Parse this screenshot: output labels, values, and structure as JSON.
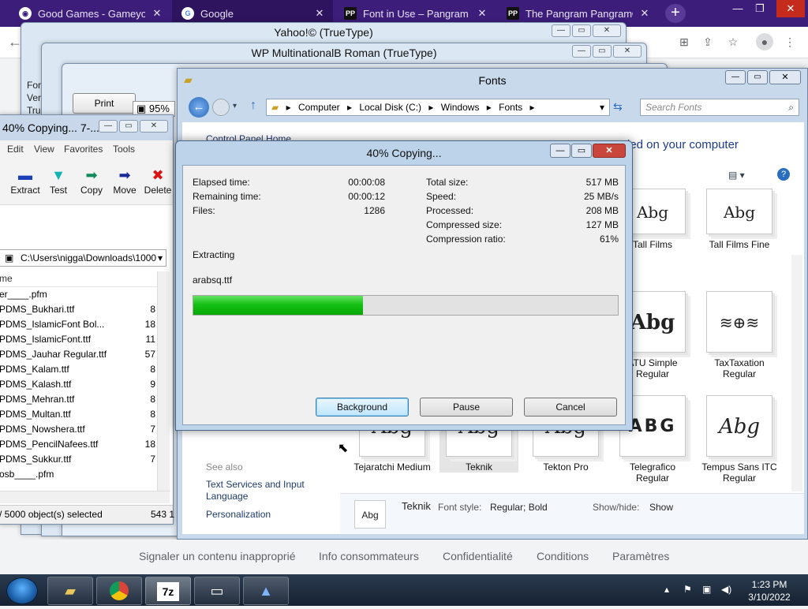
{
  "browser": {
    "tabs": [
      {
        "label": "Good Games - Gameyounc",
        "icon": "gamepad-icon"
      },
      {
        "label": "Google",
        "icon": "google-icon"
      },
      {
        "label": "Font in Use – Pangram Par",
        "icon": "pangram-icon"
      },
      {
        "label": "The Pangram Pangram® F",
        "icon": "pangram-icon"
      }
    ],
    "new_tab": "+",
    "footer_links": [
      "Signaler un contenu inapproprié",
      "Info consommateurs",
      "Confidentialité",
      "Conditions",
      "Paramètres"
    ]
  },
  "bg_windows": {
    "yahoo_title": "Yahoo!© (TrueType)",
    "wp_title": "WP MultinationalB Roman (TrueType)",
    "print_label": "Print",
    "zoom": "95%",
    "side_text": [
      "For",
      "Ver",
      "Tru"
    ]
  },
  "zip": {
    "title": "40% Copying... 7-...",
    "menu": [
      "Edit",
      "View",
      "Favorites",
      "Tools"
    ],
    "tools": [
      "Extract",
      "Test",
      "Copy",
      "Move",
      "Delete"
    ],
    "path": "C:\\Users\\nigga\\Downloads\\1000",
    "col_name": "me",
    "files": [
      {
        "name": "er____.pfm",
        "size": ""
      },
      {
        "name": "PDMS_Bukhari.ttf",
        "size": "8"
      },
      {
        "name": "PDMS_IslamicFont Bol...",
        "size": "18"
      },
      {
        "name": "PDMS_IslamicFont.ttf",
        "size": "11"
      },
      {
        "name": "PDMS_Jauhar Regular.ttf",
        "size": "57"
      },
      {
        "name": "PDMS_Kalam.ttf",
        "size": "8"
      },
      {
        "name": "PDMS_Kalash.ttf",
        "size": "9"
      },
      {
        "name": "PDMS_Mehran.ttf",
        "size": "8"
      },
      {
        "name": "PDMS_Multan.ttf",
        "size": "8"
      },
      {
        "name": "PDMS_Nowshera.ttf",
        "size": "7"
      },
      {
        "name": "PDMS_PencilNafees.ttf",
        "size": "18"
      },
      {
        "name": "PDMS_Sukkur.ttf",
        "size": "7"
      },
      {
        "name": "osb____.pfm",
        "size": ""
      }
    ],
    "status_left": "/ 5000 object(s) selected",
    "status_right": "543 1"
  },
  "fonts_window": {
    "title": "Fonts",
    "breadcrumb": [
      "Computer",
      "Local Disk (C:)",
      "Windows",
      "Fonts"
    ],
    "search_placeholder": "Search Fonts",
    "control_panel_home": "Control Panel Home",
    "header_text": "led on your computer",
    "see_also": "See also",
    "links": [
      "Text Services and Input Language",
      "Personalization"
    ],
    "tiles": [
      {
        "name": "Tall Films",
        "preview": "Abg"
      },
      {
        "name": "Tall Films Fine",
        "preview": "Abg"
      },
      {
        "name": "ATU Simple Regular",
        "preview": "Abg"
      },
      {
        "name": "TaxTaxation Regular",
        "preview": "≋⊕≋"
      },
      {
        "name": "Tejaratchi Medium",
        "preview": "Abg"
      },
      {
        "name": "Teknik",
        "preview": "Abg"
      },
      {
        "name": "Tekton Pro",
        "preview": "Abg"
      },
      {
        "name": "Telegrafico Regular",
        "preview": "ABG"
      },
      {
        "name": "Tempus Sans ITC Regular",
        "preview": "Abg"
      }
    ],
    "details": {
      "name": "Teknik",
      "style_label": "Font style:",
      "style_value": "Regular; Bold",
      "show_label": "Show/hide:",
      "show_value": "Show",
      "preview": "Abg"
    }
  },
  "dialog": {
    "title": "40% Copying...",
    "elapsed_label": "Elapsed time:",
    "elapsed": "00:00:08",
    "remaining_label": "Remaining time:",
    "remaining": "00:00:12",
    "files_label": "Files:",
    "files": "1286",
    "total_label": "Total size:",
    "total": "517 MB",
    "speed_label": "Speed:",
    "speed": "25 MB/s",
    "processed_label": "Processed:",
    "processed": "208 MB",
    "compressed_label": "Compressed size:",
    "compressed": "127 MB",
    "ratio_label": "Compression ratio:",
    "ratio": "61%",
    "operation": "Extracting",
    "current_file": "arabsq.ttf",
    "progress": 0.4,
    "buttons": {
      "background": "Background",
      "pause": "Pause",
      "cancel": "Cancel"
    }
  },
  "taskbar": {
    "time": "1:23 PM",
    "date": "3/10/2022",
    "apps": [
      "folder-icon",
      "chrome-icon",
      "7zip-icon",
      "monitor-icon",
      "font-app-icon"
    ]
  }
}
